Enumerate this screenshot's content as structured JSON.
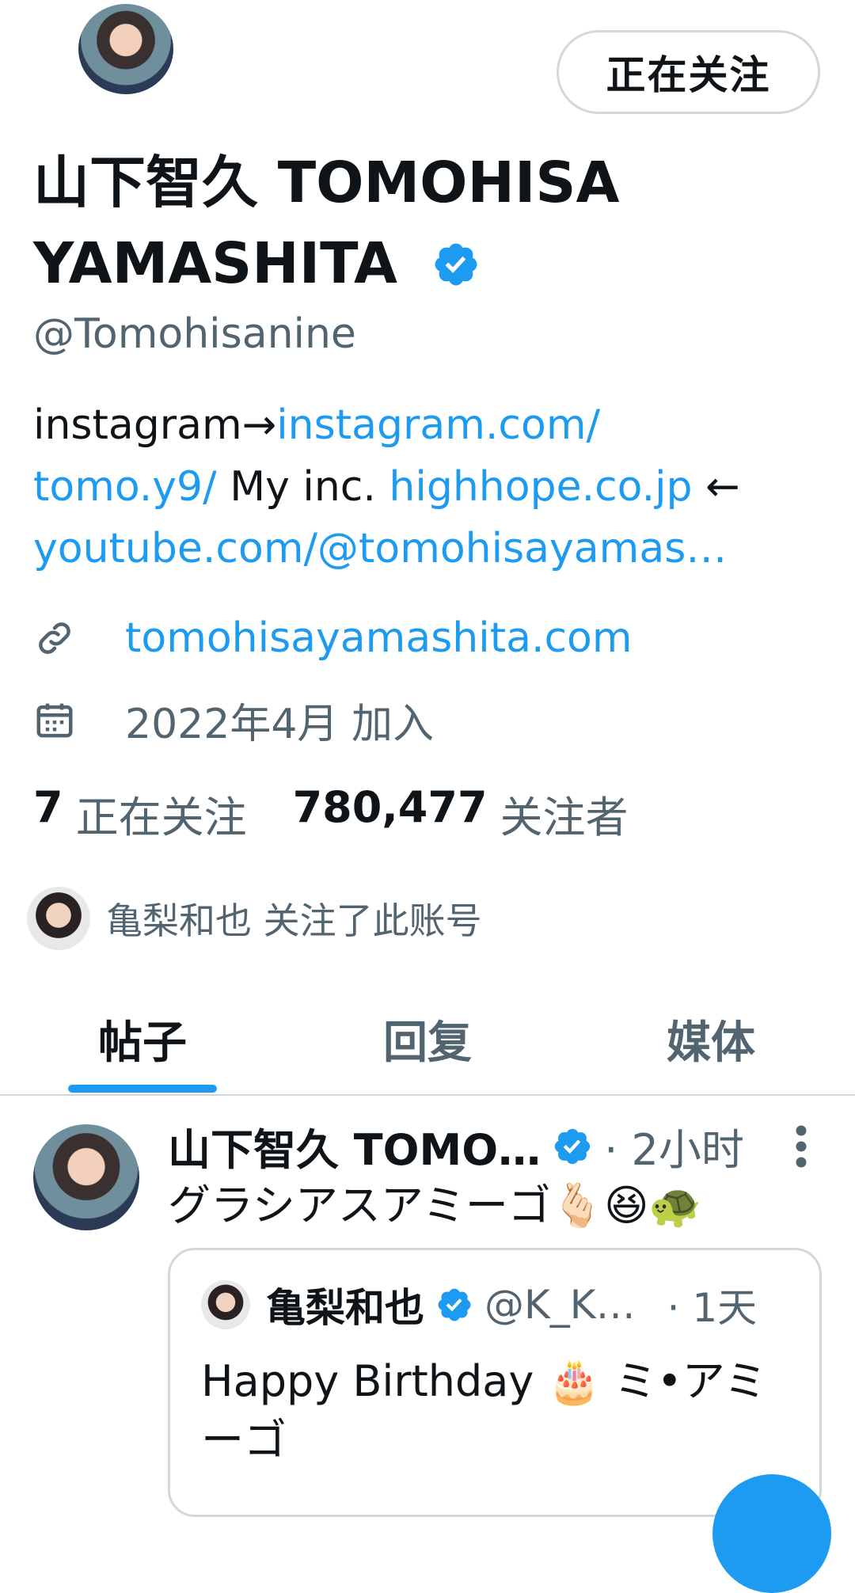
{
  "profile": {
    "follow_button": "正在关注",
    "display_name_line1": "山下智久 TOMOHISA",
    "display_name_line2": "YAMASHITA",
    "handle": "@Tomohisanine",
    "bio": {
      "t1": "instagram→",
      "l1": "instagram.com/",
      "l1b": "tomo.y9/",
      "t2": " My inc. ",
      "l2": "highhope.co.jp",
      "t3": " ←",
      "l3": "youtube.com/@tomohisayamas…"
    },
    "website": "tomohisayamashita.com",
    "joined": "2022年4月 加入",
    "following_count": "7",
    "following_label": "正在关注",
    "followers_count": "780,477",
    "followers_label": "关注者",
    "followed_by": "亀梨和也 关注了此账号"
  },
  "tabs": [
    {
      "label": "帖子",
      "active": true
    },
    {
      "label": "回复",
      "active": false
    },
    {
      "label": "媒体",
      "active": false
    }
  ],
  "post": {
    "name": "山下智久 TOMO…",
    "time": "· 2小时",
    "text": "グラシアスアミーゴ🫰🏻😆🐢",
    "quote": {
      "name": "亀梨和也",
      "handle": "@K_K…",
      "time": "· 1天",
      "text": "Happy Birthday 🎂 ミ•アミーゴ"
    }
  },
  "colors": {
    "accent": "#1d9bf0",
    "secondary_text": "#536471",
    "border": "#cfd9de"
  },
  "icons": [
    "verified-badge-icon",
    "link-icon",
    "calendar-icon",
    "more-icon"
  ]
}
